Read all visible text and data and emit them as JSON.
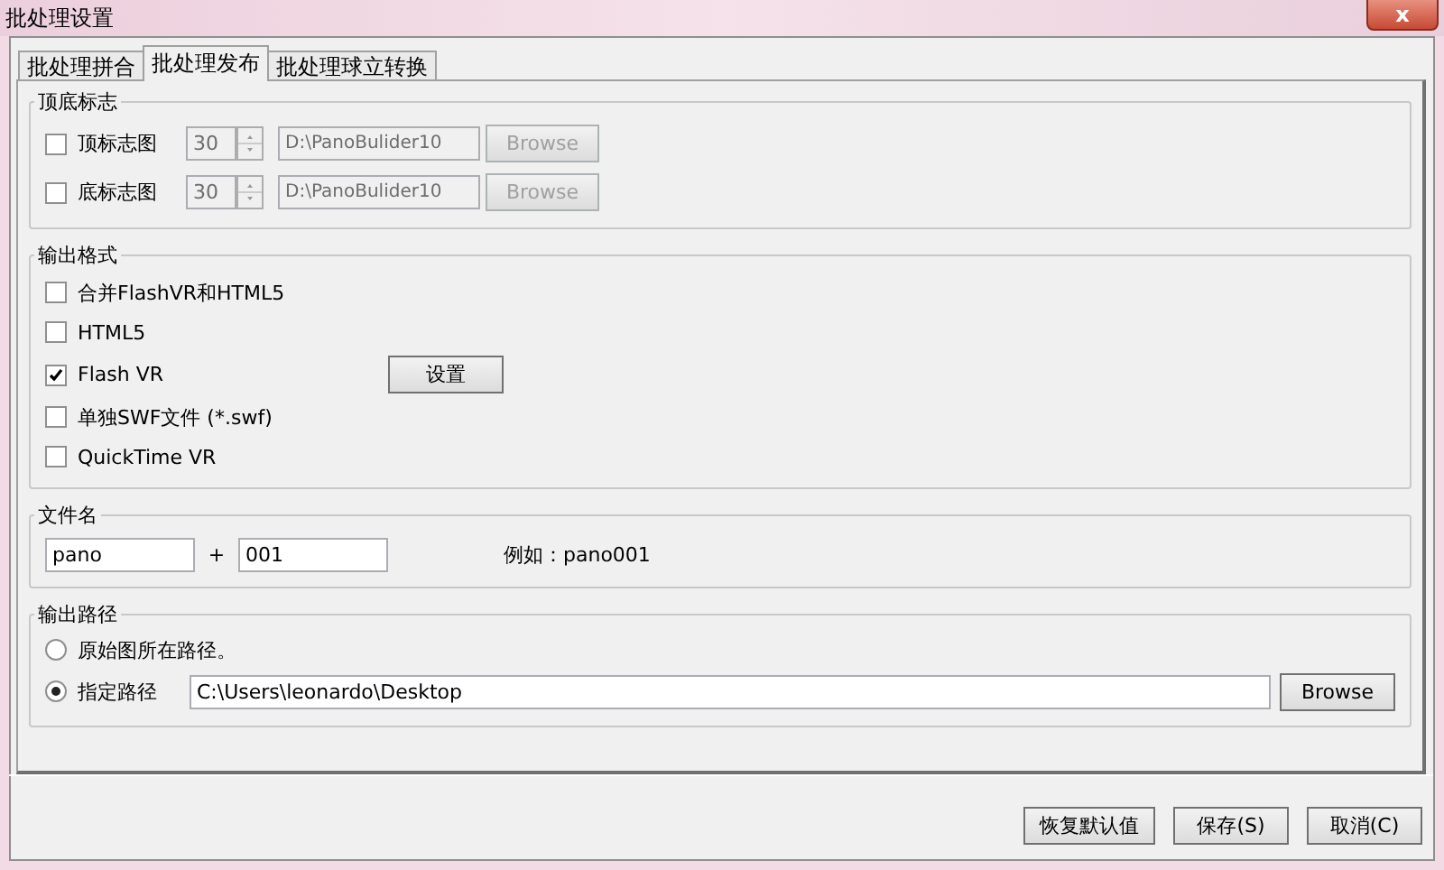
{
  "window": {
    "title": "批处理设置",
    "close": "x"
  },
  "tabs": [
    {
      "label": "批处理拼合",
      "selected": false
    },
    {
      "label": "批处理发布",
      "selected": true
    },
    {
      "label": "批处理球立转换",
      "selected": false
    }
  ],
  "logo_group": {
    "title": "顶底标志",
    "rows": [
      {
        "label": "顶标志图",
        "checked": false,
        "disabled": true,
        "size": "30",
        "path": "D:\\PanoBulider10",
        "button": "Browse"
      },
      {
        "label": "底标志图",
        "checked": false,
        "disabled": true,
        "size": "30",
        "path": "D:\\PanoBulider10",
        "button": "Browse"
      }
    ]
  },
  "format_group": {
    "title": "输出格式",
    "options": [
      {
        "label": "合并FlashVR和HTML5",
        "checked": false
      },
      {
        "label": "HTML5",
        "checked": false
      },
      {
        "label": "Flash VR",
        "checked": true,
        "button": "设置"
      },
      {
        "label": "单独SWF文件 (*.swf)",
        "checked": false
      },
      {
        "label": "QuickTime VR",
        "checked": false
      }
    ]
  },
  "name_group": {
    "title": "文件名",
    "prefix": "pano",
    "joiner": "+",
    "suffix": "001",
    "example": "例如：pano001"
  },
  "path_group": {
    "title": "输出路径",
    "options": [
      {
        "label": "原始图所在路径。",
        "selected": false,
        "kind": "plain"
      },
      {
        "label": "指定路径",
        "selected": true,
        "kind": "path",
        "path": "C:\\Users\\leonardo\\Desktop",
        "button": "Browse"
      }
    ]
  },
  "buttons": [
    "恢复默认值",
    "保存(S)",
    "取消(C)"
  ]
}
